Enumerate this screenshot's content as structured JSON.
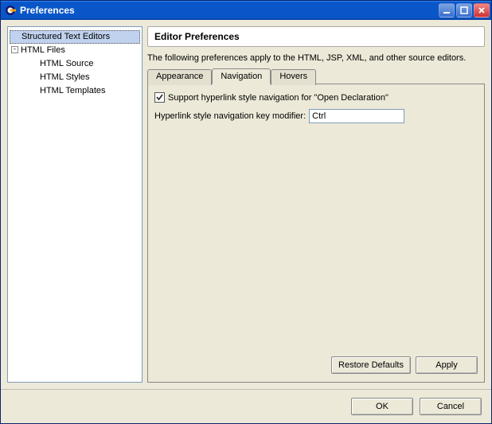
{
  "window": {
    "title": "Preferences"
  },
  "tree": {
    "items": [
      {
        "label": "Structured Text Editors",
        "level": 1,
        "selected": true,
        "expandable": false
      },
      {
        "label": "HTML Files",
        "level": 1,
        "selected": false,
        "expandable": true,
        "expanded": true
      },
      {
        "label": "HTML Source",
        "level": 2,
        "selected": false
      },
      {
        "label": "HTML Styles",
        "level": 2,
        "selected": false
      },
      {
        "label": "HTML Templates",
        "level": 2,
        "selected": false
      }
    ]
  },
  "panel": {
    "header": "Editor Preferences",
    "description": "The following preferences apply to the HTML, JSP, XML, and other source editors."
  },
  "tabs": {
    "items": [
      {
        "label": "Appearance",
        "active": false
      },
      {
        "label": "Navigation",
        "active": true
      },
      {
        "label": "Hovers",
        "active": false
      }
    ]
  },
  "navigation": {
    "checkbox_label": "Support hyperlink style navigation for \"Open Declaration\"",
    "checkbox_checked": true,
    "modifier_label": "Hyperlink style navigation key modifier:",
    "modifier_value": "Ctrl"
  },
  "buttons": {
    "restore_defaults": "Restore Defaults",
    "apply": "Apply",
    "ok": "OK",
    "cancel": "Cancel"
  }
}
